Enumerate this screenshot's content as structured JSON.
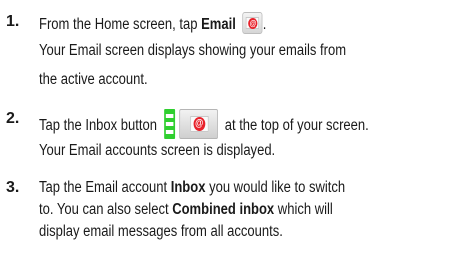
{
  "steps": [
    {
      "number": "1.",
      "lines": [
        {
          "pre": "From the Home screen, tap ",
          "bold": "Email",
          "post": ""
        },
        {
          "text": "Your Email screen displays showing your emails from"
        },
        {
          "text": "the active account."
        }
      ],
      "icon": "email-at-icon"
    },
    {
      "number": "2.",
      "lines": [
        {
          "pre": "Tap the Inbox button",
          "post": "at the top of your screen."
        },
        {
          "text": "Your Email accounts screen is displayed."
        }
      ],
      "icon": "inbox-button-icon"
    },
    {
      "number": "3.",
      "lines": [
        {
          "pre": "Tap the Email account ",
          "bold": "Inbox",
          "post": " you would like to switch"
        },
        {
          "pre": "to. You can also select ",
          "bold": "Combined inbox",
          "post": " which will"
        },
        {
          "text": "display email messages from all accounts."
        }
      ]
    }
  ],
  "trailing_period": ".",
  "colors": {
    "text": "#1a1a1a",
    "inbox_list_green": "#2fcf2f",
    "email_at_red": "#e8222b"
  }
}
